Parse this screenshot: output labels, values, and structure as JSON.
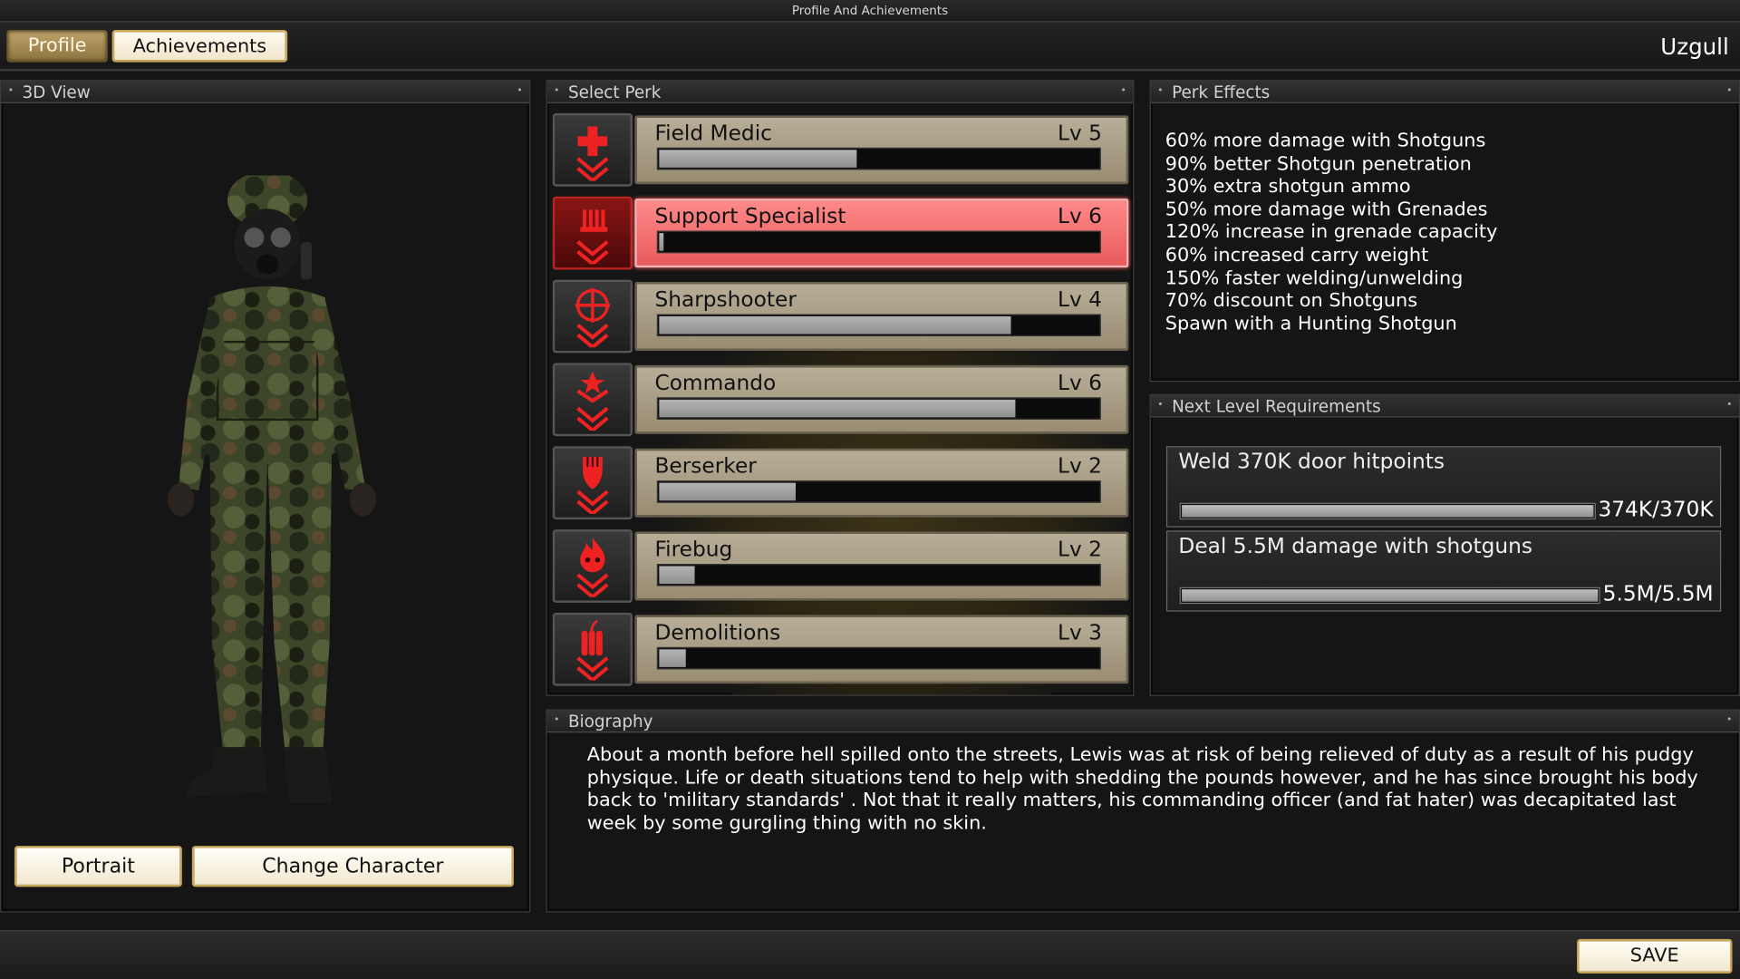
{
  "window": {
    "title": "Profile And Achievements"
  },
  "toolbar": {
    "tab_profile": "Profile",
    "tab_achievements": "Achievements",
    "username": "Uzgull"
  },
  "view3d": {
    "title": "3D View",
    "portrait_label": "Portrait",
    "change_label": "Change Character"
  },
  "perks": {
    "title": "Select Perk",
    "items": [
      {
        "name": "Field Medic",
        "level": "Lv 5",
        "progress": 0.45,
        "icon": "medic-cross-icon",
        "selected": false
      },
      {
        "name": "Support Specialist",
        "level": "Lv 6",
        "progress": 0.01,
        "icon": "ammo-belt-icon",
        "selected": true
      },
      {
        "name": "Sharpshooter",
        "level": "Lv 4",
        "progress": 0.8,
        "icon": "crosshair-icon",
        "selected": false
      },
      {
        "name": "Commando",
        "level": "Lv 6",
        "progress": 0.81,
        "icon": "star-chevron-icon",
        "selected": false
      },
      {
        "name": "Berserker",
        "level": "Lv 2",
        "progress": 0.31,
        "icon": "fist-icon",
        "selected": false
      },
      {
        "name": "Firebug",
        "level": "Lv 2",
        "progress": 0.08,
        "icon": "flame-skull-icon",
        "selected": false
      },
      {
        "name": "Demolitions",
        "level": "Lv 3",
        "progress": 0.06,
        "icon": "dynamite-icon",
        "selected": false
      }
    ]
  },
  "effects": {
    "title": "Perk Effects",
    "lines": [
      "60% more damage with Shotguns",
      "90% better Shotgun penetration",
      "30% extra shotgun ammo",
      "50% more damage with Grenades",
      "120% increase in grenade capacity",
      "60% increased carry weight",
      "150% faster welding/unwelding",
      "70% discount on Shotguns",
      "Spawn with a Hunting Shotgun"
    ]
  },
  "next_level": {
    "title": "Next Level Requirements",
    "requirements": [
      {
        "text": "Weld 370K door hitpoints",
        "value": "374K/370K",
        "progress": 1.0
      },
      {
        "text": "Deal 5.5M damage with shotguns",
        "value": "5.5M/5.5M",
        "progress": 1.0
      }
    ]
  },
  "biography": {
    "title": "Biography",
    "text": "About a month before hell spilled onto the streets, Lewis was at risk of being relieved of duty as a result of his pudgy physique. Life or death situations tend to help with shedding the pounds however, and he has since brought his body back to 'military standards' .  Not that it really matters, his commanding officer (and fat hater) was decapitated last week by some gurgling thing with no skin."
  },
  "footer": {
    "save_label": "SAVE"
  },
  "colors": {
    "accent_red": "#e85a5a",
    "perk_tan": "#b0a68e",
    "button_gold": "#c9a85c"
  }
}
